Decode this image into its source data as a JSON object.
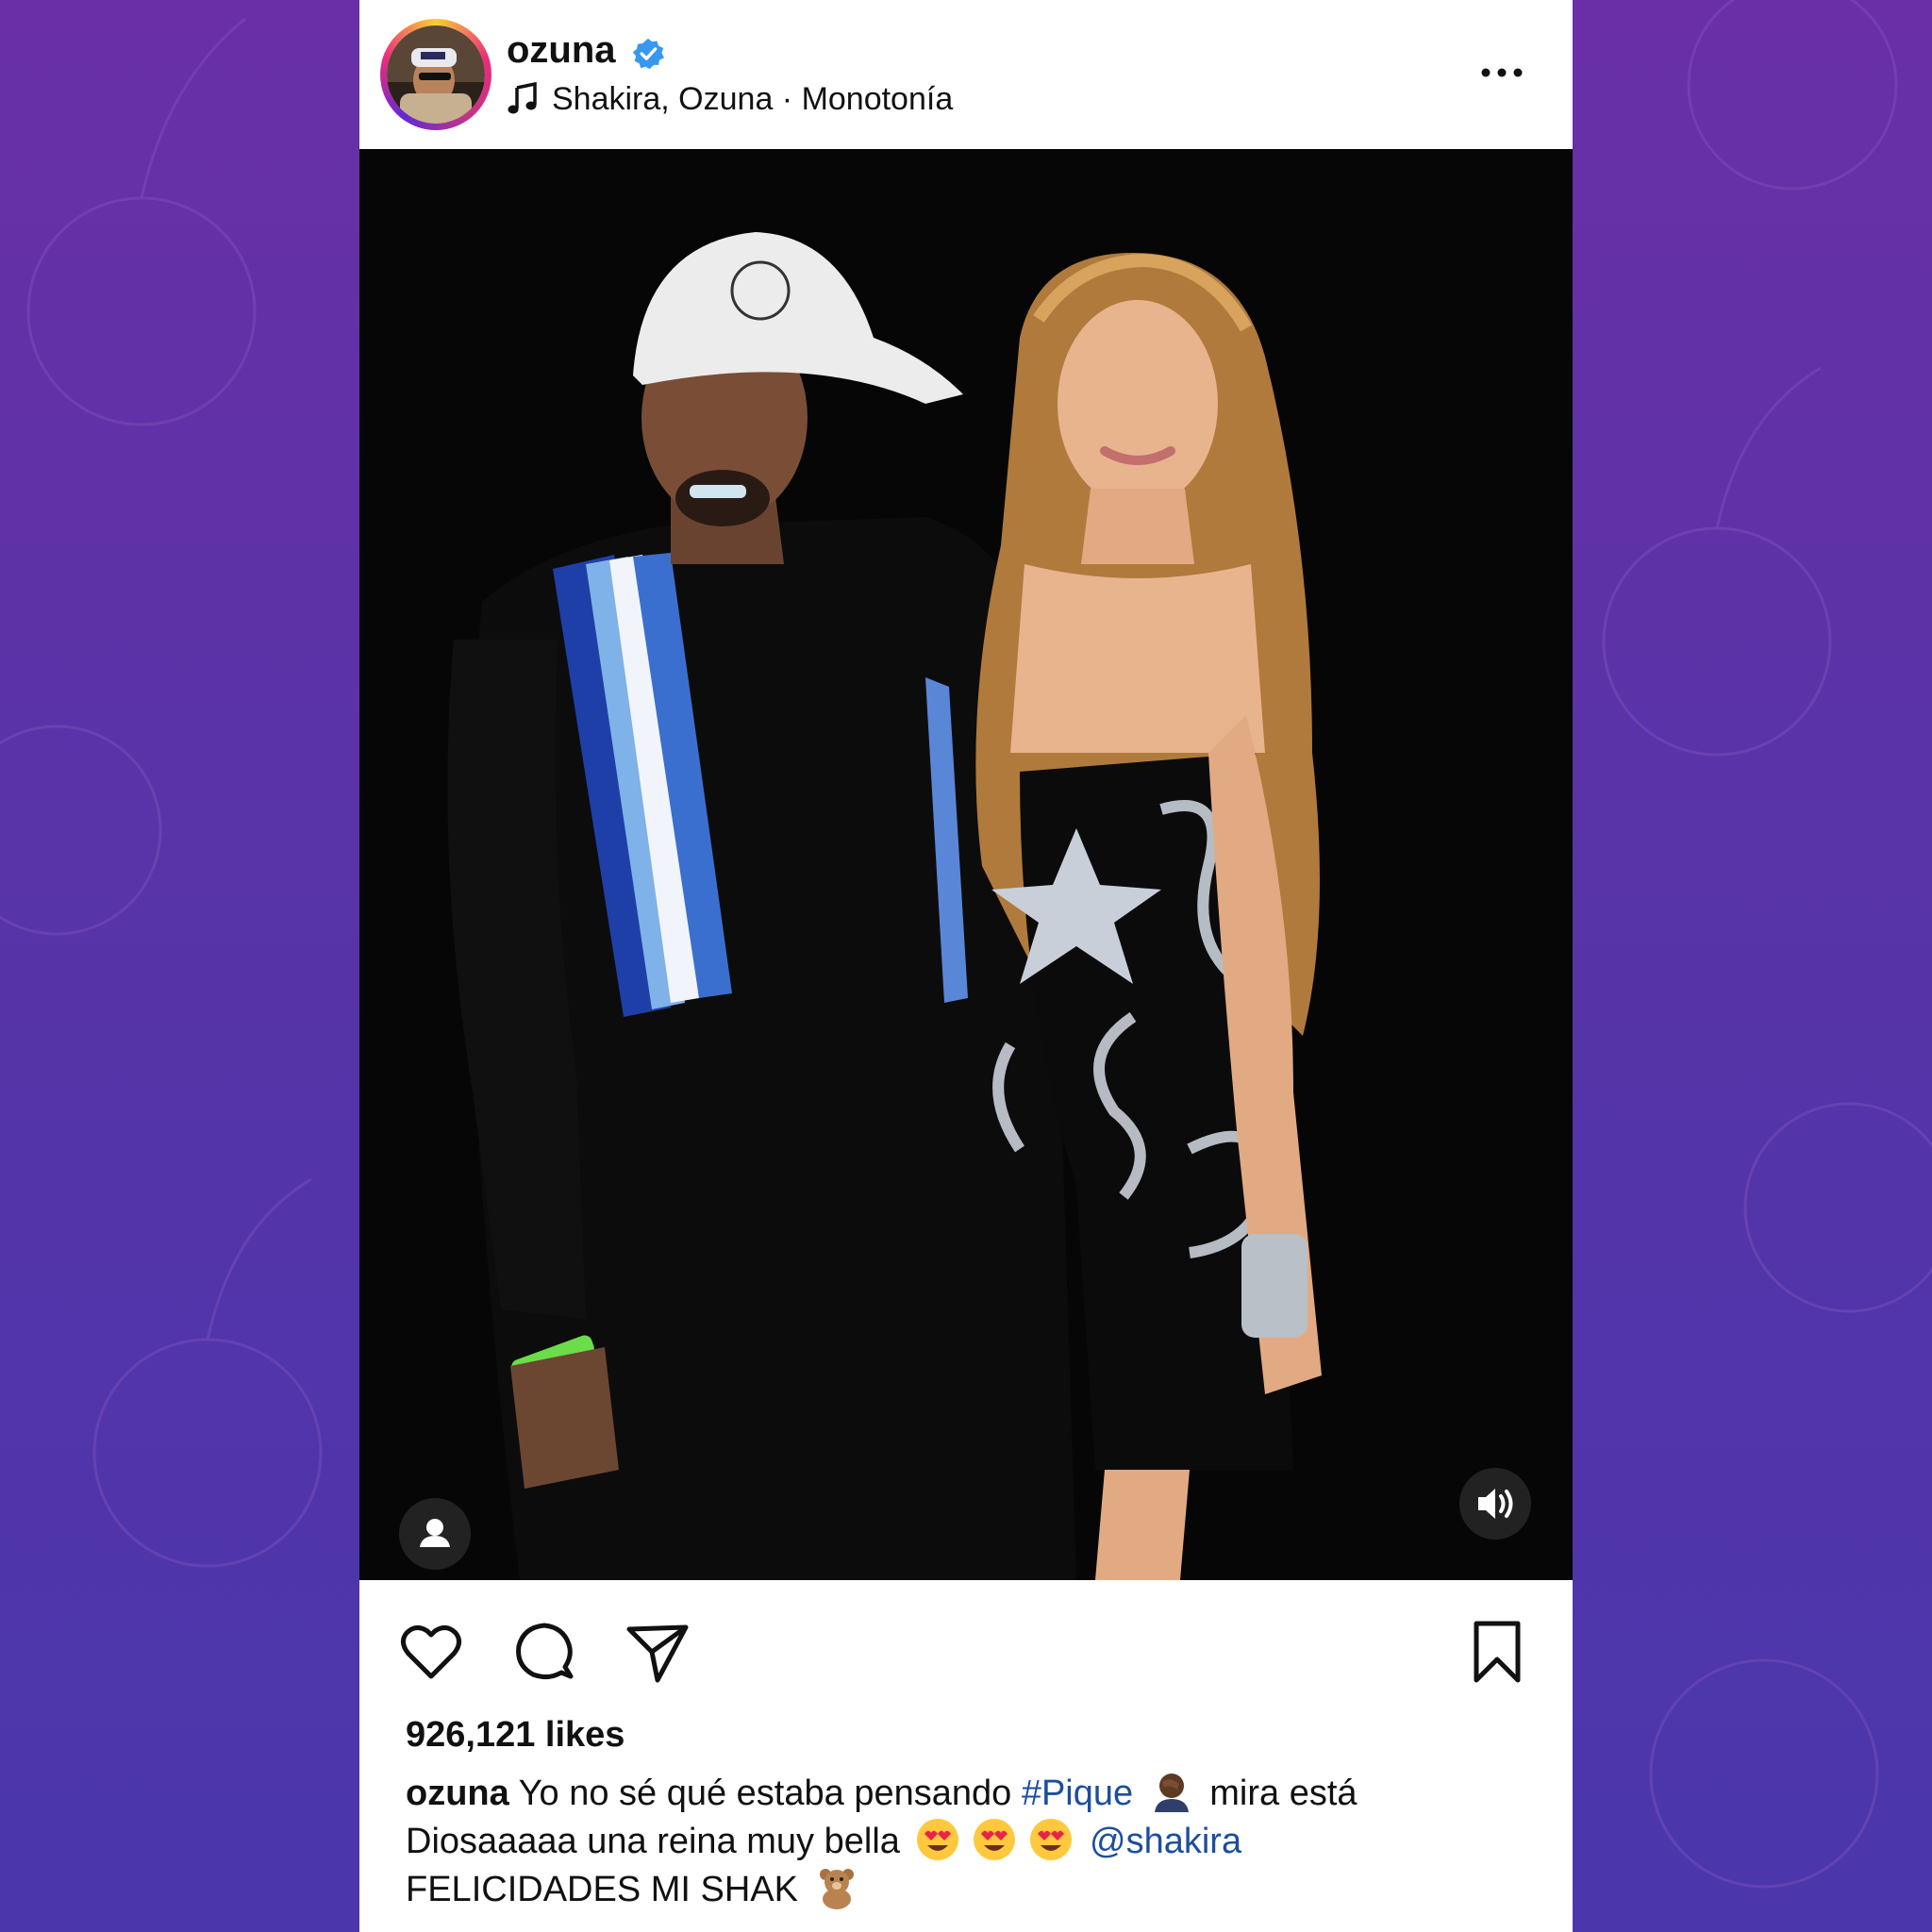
{
  "colors": {
    "background_top": "#6a2fa6",
    "background_bottom": "#4b36ac",
    "verified_blue": "#3897f0",
    "link_blue": "#1d4e9e",
    "text": "#111111"
  },
  "header": {
    "avatar_icon": "profile-avatar",
    "username": "ozuna",
    "verified_icon": "verified-badge-icon",
    "music_icon": "music-note-icon",
    "music": "Shakira, Ozuna · Monotonía",
    "more_icon": "more-options-icon"
  },
  "media": {
    "tag_icon": "user-tag-icon",
    "volume_icon": "volume-icon"
  },
  "actions": {
    "like_icon": "heart-icon",
    "comment_icon": "comment-icon",
    "share_icon": "share-icon",
    "save_icon": "bookmark-icon"
  },
  "likes": "926,121 likes",
  "caption": {
    "username": "ozuna",
    "line1_text": " Yo no sé qué estaba pensando ",
    "hashtag": "#Pique",
    "line1_after": " mira está",
    "line2_text": "Diosaaaaa una reina muy bella ",
    "mention": "@shakira",
    "line3_text": "FELICIDADES MI SHAK ",
    "emojis": [
      "facepalm",
      "heart-eyes",
      "heart-eyes",
      "heart-eyes",
      "teddy-bear"
    ]
  }
}
